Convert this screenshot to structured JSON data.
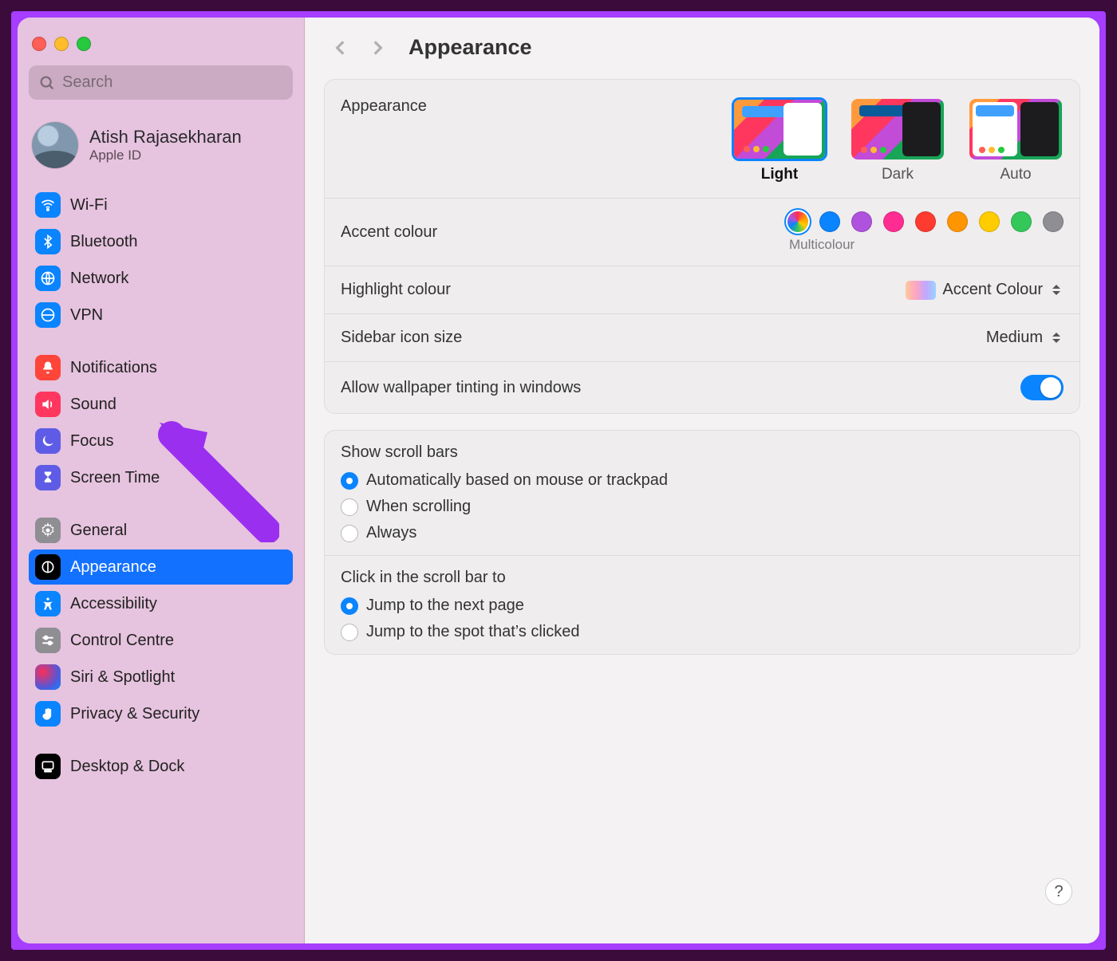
{
  "search": {
    "placeholder": "Search"
  },
  "account": {
    "name": "Atish Rajasekharan",
    "sub": "Apple ID"
  },
  "sidebar": {
    "g1": [
      {
        "id": "wifi",
        "label": "Wi-Fi"
      },
      {
        "id": "bluetooth",
        "label": "Bluetooth"
      },
      {
        "id": "network",
        "label": "Network"
      },
      {
        "id": "vpn",
        "label": "VPN"
      }
    ],
    "g2": [
      {
        "id": "notifications",
        "label": "Notifications"
      },
      {
        "id": "sound",
        "label": "Sound"
      },
      {
        "id": "focus",
        "label": "Focus"
      },
      {
        "id": "screentime",
        "label": "Screen Time"
      }
    ],
    "g3": [
      {
        "id": "general",
        "label": "General"
      },
      {
        "id": "appearance",
        "label": "Appearance",
        "selected": true
      },
      {
        "id": "accessibility",
        "label": "Accessibility"
      },
      {
        "id": "controlcentre",
        "label": "Control Centre"
      },
      {
        "id": "siri",
        "label": "Siri & Spotlight"
      },
      {
        "id": "privacy",
        "label": "Privacy & Security"
      }
    ],
    "g4": [
      {
        "id": "desktop",
        "label": "Desktop & Dock"
      }
    ]
  },
  "title": "Appearance",
  "appearance": {
    "label": "Appearance",
    "options": {
      "light": "Light",
      "dark": "Dark",
      "auto": "Auto"
    },
    "selected": "Light"
  },
  "accent": {
    "label": "Accent colour",
    "sublabel": "Multicolour",
    "colors": [
      "conic-gradient(#ff2d55,#ff9500,#ffcc00,#34c759,#0a84ff,#af52de,#ff2d55)",
      "#0a84ff",
      "#af52de",
      "#ff2d92",
      "#ff3b30",
      "#ff9500",
      "#ffcc00",
      "#34c759",
      "#8e8e93"
    ],
    "selected": 0
  },
  "highlight": {
    "label": "Highlight colour",
    "value": "Accent Colour"
  },
  "sidebariconsize": {
    "label": "Sidebar icon size",
    "value": "Medium"
  },
  "tinting": {
    "label": "Allow wallpaper tinting in windows",
    "on": true
  },
  "scrollbars": {
    "title": "Show scroll bars",
    "items": [
      {
        "label": "Automatically based on mouse or trackpad",
        "sel": true
      },
      {
        "label": "When scrolling",
        "sel": false
      },
      {
        "label": "Always",
        "sel": false
      }
    ]
  },
  "scrollclick": {
    "title": "Click in the scroll bar to",
    "items": [
      {
        "label": "Jump to the next page",
        "sel": true
      },
      {
        "label": "Jump to the spot that’s clicked",
        "sel": false
      }
    ]
  },
  "help": "?"
}
